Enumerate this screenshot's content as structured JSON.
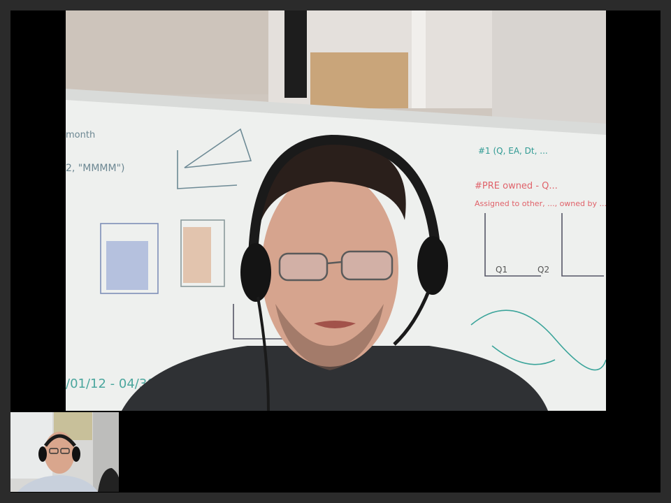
{
  "window": {
    "background_color": "#2b2b2b",
    "stage_color": "#000000"
  },
  "remote_video": {
    "participant": "remote-participant",
    "scene": "office-whiteboard",
    "whiteboard_texts": {
      "left_top": "month",
      "left_format": "2, \"MMMM\")",
      "right_top": "#1 (Q, EA, Dt, ...",
      "right_red_1": "#PRE owned - Q...",
      "right_red_2": "Assigned to other, ..., owned by ...",
      "bottom_left": "/01/12 - 04/30/...",
      "chart_label_q1": "Q1",
      "chart_label_q2": "Q2"
    },
    "icons": [
      "headset-icon",
      "glasses"
    ]
  },
  "self_view": {
    "participant": "local-participant",
    "icons": [
      "headset-icon"
    ]
  }
}
